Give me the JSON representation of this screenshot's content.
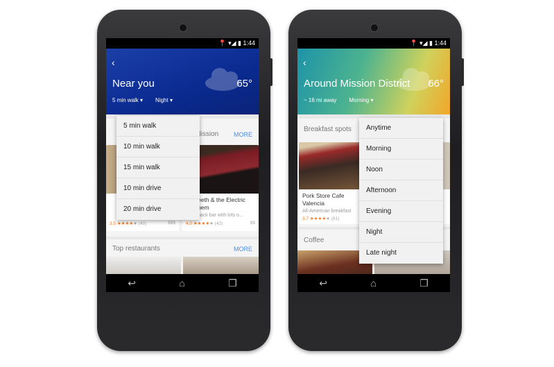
{
  "left": {
    "status_time": "1:44",
    "header": {
      "title": "Near you",
      "temperature": "65°",
      "distance": "5 min walk",
      "time": "Night"
    },
    "section1": {
      "title_visible": "e Mission",
      "more": "MORE",
      "cards": [
        {
          "rating": "3.5",
          "reviews": "(40)",
          "price": "$$$"
        },
        {
          "name_line1": "eeth & the Electric",
          "name_line2": "hem",
          "subtitle": "back bar with lots o...",
          "rating": "4.0",
          "reviews": "(42)",
          "price": "$$"
        }
      ]
    },
    "section2": {
      "title": "Top restaurants",
      "more": "MORE"
    },
    "dropdown": [
      "5 min walk",
      "10 min walk",
      "15 min walk",
      "10 min drive",
      "20 min drive"
    ]
  },
  "right": {
    "status_time": "1:44",
    "header": {
      "title": "Around Mission District",
      "temperature": "66°",
      "distance": "~ 16 mi away",
      "time": "Morning"
    },
    "section1": {
      "title": "Breakfast spots",
      "cards": [
        {
          "name_line1": "Pork Store Cafe",
          "name_line2": "Valencia",
          "subtitle": "All-American breakfast",
          "rating": "3.7",
          "reviews": "(61)"
        }
      ]
    },
    "section2": {
      "title": "Coffee"
    },
    "dropdown": [
      "Anytime",
      "Morning",
      "Noon",
      "Afternoon",
      "Evening",
      "Night",
      "Late night"
    ]
  },
  "icons": {
    "back": "chevron-left-icon",
    "weather": "cloud-icon",
    "nav": [
      "back-icon",
      "home-icon",
      "recents-icon"
    ]
  },
  "colors": {
    "left_header": "#0a2a90",
    "right_header_start": "#1d93a8",
    "right_header_end": "#f2a62a",
    "link": "#4a8ee8",
    "rating": "#f07a20"
  }
}
